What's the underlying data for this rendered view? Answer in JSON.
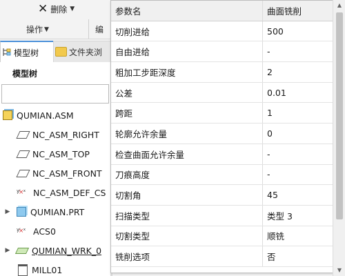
{
  "ribbon": {
    "delete_label": "删除",
    "group_operations": "操作",
    "group_edit": "编"
  },
  "tabs": [
    {
      "label": "模型树"
    },
    {
      "label": "文件夹浏"
    }
  ],
  "panel": {
    "title": "模型树",
    "search_value": ""
  },
  "tree": [
    {
      "label": "QUMIAN.ASM",
      "icon": "assembly-icon",
      "expandable": false
    },
    {
      "label": "NC_ASM_RIGHT",
      "icon": "datum-plane-icon",
      "expandable": false
    },
    {
      "label": "NC_ASM_TOP",
      "icon": "datum-plane-icon",
      "expandable": false
    },
    {
      "label": "NC_ASM_FRONT",
      "icon": "datum-plane-icon",
      "expandable": false
    },
    {
      "label": "NC_ASM_DEF_CS",
      "icon": "coordinate-system-icon",
      "expandable": false
    },
    {
      "label": "QUMIAN.PRT",
      "icon": "part-icon",
      "expandable": true
    },
    {
      "label": "ACS0",
      "icon": "coordinate-system-icon",
      "expandable": false
    },
    {
      "label": "QUMIAN_WRK_0",
      "icon": "workpiece-icon",
      "expandable": true
    },
    {
      "label": "MILL01",
      "icon": "mill-operation-icon",
      "expandable": false
    }
  ],
  "params_table": {
    "headers": [
      "参数名",
      "曲面铣削"
    ],
    "rows": [
      [
        "切削进给",
        "500"
      ],
      [
        "自由进给",
        "-"
      ],
      [
        "粗加工步距深度",
        "2"
      ],
      [
        "公差",
        "0.01"
      ],
      [
        "跨距",
        "1"
      ],
      [
        "轮廓允许余量",
        "0"
      ],
      [
        "检查曲面允许余量",
        "-"
      ],
      [
        "刀痕高度",
        "-"
      ],
      [
        "切割角",
        "45"
      ],
      [
        "扫描类型",
        "类型 3"
      ],
      [
        "切割类型",
        "顺铣"
      ],
      [
        "铣削选项",
        "否"
      ]
    ]
  }
}
